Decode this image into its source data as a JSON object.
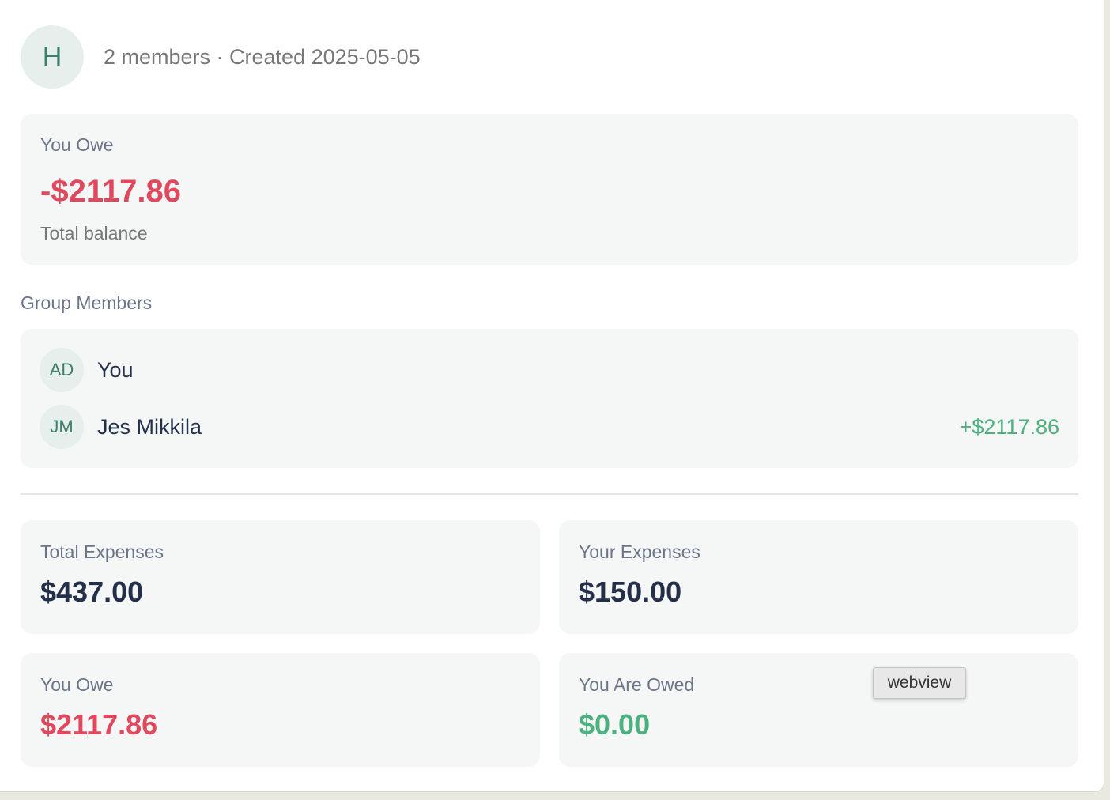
{
  "group": {
    "avatar_initial": "H",
    "meta": "2 members · Created 2025-05-05"
  },
  "balance": {
    "label": "You Owe",
    "amount": "-$2117.86",
    "sublabel": "Total balance",
    "color": "#e0485e"
  },
  "members": {
    "title": "Group Members",
    "items": [
      {
        "initials": "AD",
        "name": "You",
        "balance": ""
      },
      {
        "initials": "JM",
        "name": "Jes Mikkila",
        "balance": "+$2117.86"
      }
    ]
  },
  "stats": [
    {
      "label": "Total Expenses",
      "value": "$437.00"
    },
    {
      "label": "Your Expenses",
      "value": "$150.00"
    },
    {
      "label": "You Owe",
      "value": "$2117.86",
      "color": "#e0485e"
    },
    {
      "label": "You Are Owed",
      "value": "$0.00",
      "color": "#4cb17e"
    }
  ],
  "tooltip": {
    "text": "webview"
  }
}
